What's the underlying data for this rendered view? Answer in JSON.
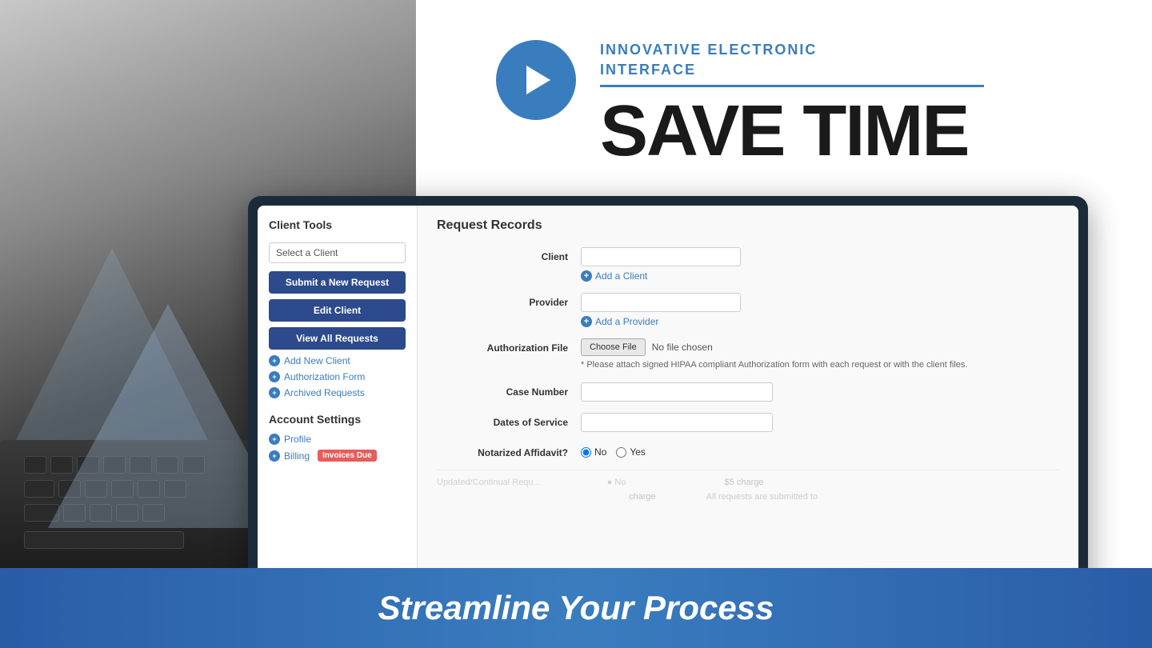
{
  "header": {
    "tagline_line1": "INNOVATIVE ELECTRONIC",
    "tagline_line2": "INTERFACE",
    "headline": "SAVE TIME",
    "play_button_label": "Play video"
  },
  "sidebar": {
    "title": "Client Tools",
    "client_select_placeholder": "Select a Client",
    "client_select_options": [
      "Select a Client"
    ],
    "buttons": [
      {
        "id": "submit-new-request",
        "label": "Submit a New Request"
      },
      {
        "id": "edit-client",
        "label": "Edit Client"
      },
      {
        "id": "view-all-requests",
        "label": "View All Requests"
      }
    ],
    "links": [
      {
        "id": "add-new-client",
        "label": "Add New Client"
      },
      {
        "id": "authorization-form",
        "label": "Authorization Form"
      },
      {
        "id": "archived-requests",
        "label": "Archived Requests"
      }
    ],
    "account_settings_title": "Account Settings",
    "account_links": [
      {
        "id": "profile",
        "label": "Profile"
      },
      {
        "id": "billing",
        "label": "Billing",
        "badge": "Invoices Due"
      }
    ]
  },
  "main": {
    "title": "Request Records",
    "form": {
      "client_label": "Client",
      "client_placeholder": "",
      "add_client_label": "Add a Client",
      "provider_label": "Provider",
      "provider_placeholder": "",
      "add_provider_label": "Add a Provider",
      "authorization_file_label": "Authorization File",
      "choose_file_btn": "Choose File",
      "no_file_text": "No file chosen",
      "file_hint": "* Please attach signed HIPAA compliant Authorization form with each request or with the client files.",
      "case_number_label": "Case Number",
      "dates_of_service_label": "Dates of Service",
      "notarized_affidavit_label": "Notarized Affidavit?",
      "radio_no": "No",
      "radio_yes": "Yes"
    },
    "faded_rows": [
      "Updated/Continual Requ...",
      ""
    ]
  },
  "banner": {
    "text": "Streamline Your Process"
  },
  "colors": {
    "primary_blue": "#3a7dbf",
    "dark_blue": "#2c4a8c",
    "accent_red": "#e85c5c"
  }
}
